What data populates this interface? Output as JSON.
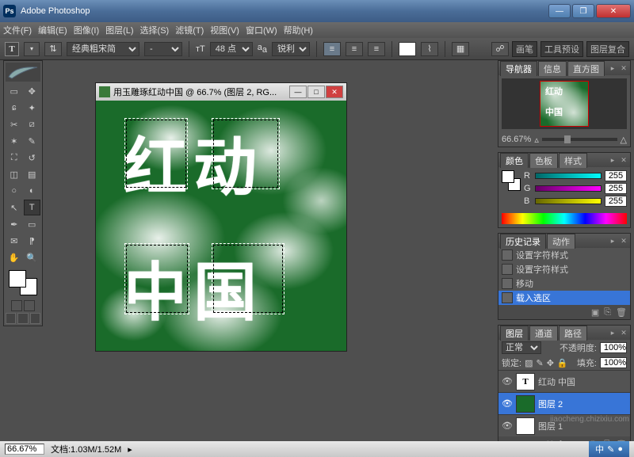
{
  "app_title": "Adobe Photoshop",
  "menu": [
    "文件(F)",
    "编辑(E)",
    "图像(I)",
    "图层(L)",
    "选择(S)",
    "滤镜(T)",
    "视图(V)",
    "窗口(W)",
    "帮助(H)"
  ],
  "opt": {
    "font_family": "经典粗宋简",
    "font_style": "-",
    "font_size_label": "T",
    "font_size": "48 点",
    "aa_label": "a_a",
    "aa": "锐利",
    "right_tabs": [
      "画笔",
      "工具预设",
      "图层复合"
    ]
  },
  "doc": {
    "title": "用玉雕琢红动中国 @ 66.7% (图层 2, RG...",
    "line1": "红动",
    "line2": "中国"
  },
  "nav": {
    "tabs": [
      "导航器",
      "信息",
      "直方图"
    ],
    "zoom": "66.67%"
  },
  "color": {
    "tabs": [
      "颜色",
      "色板",
      "样式"
    ],
    "r": "255",
    "g": "255",
    "b": "255",
    "r_label": "R",
    "g_label": "G",
    "b_label": "B"
  },
  "history": {
    "tabs": [
      "历史记录",
      "动作"
    ],
    "items": [
      "设置字符样式",
      "设置字符样式",
      "移动",
      "载入选区"
    ]
  },
  "layers": {
    "tabs": [
      "图层",
      "通道",
      "路径"
    ],
    "blend": "正常",
    "opacity_label": "不透明度:",
    "opacity": "100%",
    "lock_label": "锁定:",
    "fill_label": "填充:",
    "fill": "100%",
    "items": [
      {
        "name": "红动 中国",
        "type": "T"
      },
      {
        "name": "图层 2",
        "type": "img",
        "selected": true
      },
      {
        "name": "图层 1",
        "type": "blank"
      }
    ]
  },
  "status": {
    "zoom": "66.67%",
    "doc": "文档:1.03M/1.52M"
  },
  "watermark": "jiaocheng.chizixiu.com"
}
